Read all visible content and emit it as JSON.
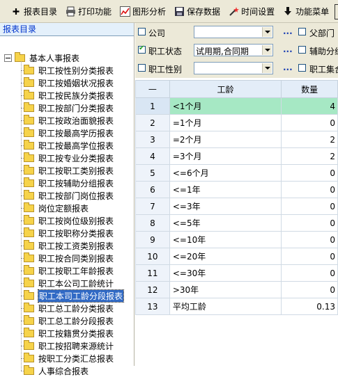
{
  "toolbar": {
    "items": [
      {
        "label": "报表目录",
        "icon": "plus-icon"
      },
      {
        "label": "打印功能",
        "icon": "printer-icon"
      },
      {
        "label": "图形分析",
        "icon": "chart-icon"
      },
      {
        "label": "保存数据",
        "icon": "save-icon"
      },
      {
        "label": "时间设置",
        "icon": "magic-wand-icon"
      },
      {
        "label": "功能菜单",
        "icon": "arrow-down-icon"
      }
    ]
  },
  "left_panel": {
    "title": "报表目录",
    "root": "基本人事报表",
    "items": [
      "职工按性别分类报表",
      "职工按婚姻状况报表",
      "职工按民族分类报表",
      "职工按部门分类报表",
      "职工按政治面貌报表",
      "职工按最高学历报表",
      "职工按最高学位报表",
      "职工按专业分类报表",
      "职工按职工类别报表",
      "职工按辅助分组报表",
      "职工按部门岗位报表",
      "岗位定额报表",
      "职工按岗位级别报表",
      "职工按职称分类报表",
      "职工按工资类别报表",
      "职工按合同类别报表",
      "职工按职工年龄报表",
      "职工本公司工龄统计",
      "职工本司工龄分段报表",
      "职工总工龄分类报表",
      "职工总工龄分段报表",
      "职工按籍贯分类报表",
      "职工按招聘来源统计",
      "按职工分类汇总报表",
      "人事综合报表"
    ],
    "selected_index": 18
  },
  "filters": {
    "rows": [
      {
        "label": "公司",
        "checked": false,
        "value": "",
        "right_label": "父部门",
        "right_checked": false
      },
      {
        "label": "职工状态",
        "checked": true,
        "value": "试用期,合同期",
        "right_label": "辅助分组",
        "right_checked": false
      },
      {
        "label": "职工性别",
        "checked": false,
        "value": "",
        "right_label": "职工集合",
        "right_checked": false
      }
    ],
    "more_button": "..."
  },
  "grid": {
    "columns": [
      "—",
      "工龄",
      "数量"
    ],
    "rows": [
      {
        "idx": "1",
        "label": "<1个月",
        "value": "4"
      },
      {
        "idx": "2",
        "label": "=1个月",
        "value": "0"
      },
      {
        "idx": "3",
        "label": "=2个月",
        "value": "2"
      },
      {
        "idx": "4",
        "label": "=3个月",
        "value": "2"
      },
      {
        "idx": "5",
        "label": "<=6个月",
        "value": "0"
      },
      {
        "idx": "6",
        "label": "<=1年",
        "value": "0"
      },
      {
        "idx": "7",
        "label": "<=3年",
        "value": "0"
      },
      {
        "idx": "8",
        "label": "<=5年",
        "value": "0"
      },
      {
        "idx": "9",
        "label": "<=10年",
        "value": "0"
      },
      {
        "idx": "10",
        "label": "<=20年",
        "value": "0"
      },
      {
        "idx": "11",
        "label": "<=30年",
        "value": "0"
      },
      {
        "idx": "12",
        "label": ">30年",
        "value": "0"
      },
      {
        "idx": "13",
        "label": "平均工龄",
        "value": "0.13"
      }
    ],
    "selected_row": 0,
    "colors": {
      "selected": "#a6e8c4",
      "header": "#e3edf8"
    }
  }
}
